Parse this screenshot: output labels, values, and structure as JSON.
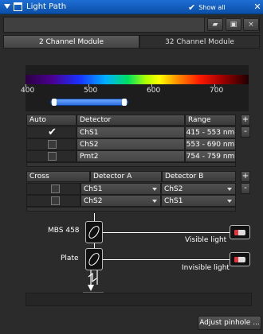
{
  "window": {
    "title": "Light Path",
    "show_all_label": "Show all",
    "close_glyph": "✕"
  },
  "tabs": [
    {
      "label": "2 Channel Module",
      "active": true
    },
    {
      "label": "32 Channel Module",
      "active": false
    }
  ],
  "spectrum": {
    "ticks": [
      "400",
      "500",
      "600",
      "700"
    ],
    "range": [
      415,
      553
    ]
  },
  "auto_correlation": {
    "headers": {
      "check": "Auto Correlation",
      "detector": "Detector",
      "range": "Range"
    },
    "add_glyph": "+",
    "remove_glyph": "-",
    "rows": [
      {
        "checked": true,
        "detector": "ChS1",
        "range": "415 - 553 nm"
      },
      {
        "checked": false,
        "detector": "ChS2",
        "range": "553 - 690 nm"
      },
      {
        "checked": false,
        "detector": "Pmt2",
        "range": "754 - 759 nm"
      }
    ]
  },
  "cross_correlation": {
    "headers": {
      "check": "Cross Correlation",
      "a": "Detector A",
      "b": "Detector B"
    },
    "add_glyph": "+",
    "remove_glyph": "-",
    "rows": [
      {
        "checked": false,
        "a": "ChS1",
        "b": "ChS2"
      },
      {
        "checked": false,
        "a": "ChS2",
        "b": "ChS1"
      }
    ]
  },
  "light_path": {
    "mbs_label": "MBS 458",
    "plate_label": "Plate",
    "visible_label": "Visible light",
    "invisible_label": "Invisible light"
  },
  "footer": {
    "adjust_label": "Adjust pinhole ..."
  }
}
